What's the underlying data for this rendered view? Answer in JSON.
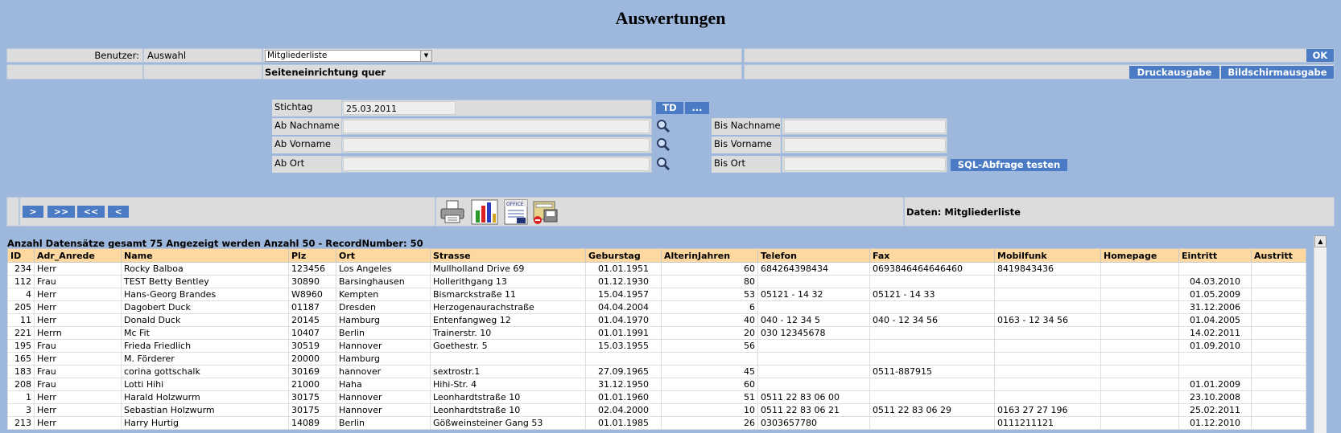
{
  "title": "Auswertungen",
  "header": {
    "benutzer_label": "Benutzer:",
    "auswahl_label": "Auswahl",
    "report_select_value": "Mitgliederliste",
    "ok_label": "OK",
    "seiten_label": "Seiteneinrichtung quer",
    "druck_label": "Druckausgabe",
    "bildschirm_label": "Bildschirmausgabe"
  },
  "filters": {
    "stichtag_label": "Stichtag",
    "stichtag_value": "25.03.2011",
    "td_label": "TD",
    "more_label": "...",
    "ab_nachname_label": "Ab Nachname",
    "bis_nachname_label": "Bis Nachname",
    "ab_vorname_label": "Ab Vorname",
    "bis_vorname_label": "Bis Vorname",
    "ab_ort_label": "Ab Ort",
    "bis_ort_label": "Bis Ort",
    "sql_test_label": "SQL-Abfrage testen"
  },
  "toolbar": {
    "next": ">",
    "last": ">>",
    "first": "<<",
    "prev": "<",
    "daten_label": "Daten: Mitgliederliste",
    "icons": [
      "printer-icon",
      "chart-icon",
      "office-icon",
      "export-icon"
    ]
  },
  "summary": "Anzahl Datensätze gesamt 75 Angezeigt werden Anzahl 50 - RecordNumber: 50",
  "table": {
    "columns": [
      "ID",
      "Adr_Anrede",
      "Name",
      "Plz",
      "Ort",
      "Strasse",
      "Geburstag",
      "AlterinJahren",
      "Telefon",
      "Fax",
      "Mobilfunk",
      "Homepage",
      "Eintritt",
      "Austritt"
    ],
    "rows": [
      [
        "234",
        "Herr",
        "Rocky Balboa",
        "123456",
        "Los Angeles",
        "Mullholland Drive 69",
        "01.01.1951",
        "60",
        "684264398434",
        "0693846464646460",
        "8419843436",
        "",
        "",
        ""
      ],
      [
        "112",
        "Frau",
        "TEST Betty Bentley",
        "30890",
        "Barsinghausen",
        "Hollerithgang 13",
        "01.12.1930",
        "80",
        "",
        "",
        "",
        "",
        "04.03.2010",
        ""
      ],
      [
        "4",
        "Herr",
        "Hans-Georg Brandes",
        "W8960",
        "Kempten",
        "Bismarckstraße 11",
        "15.04.1957",
        "53",
        "05121 - 14 32",
        "05121 - 14 33",
        "",
        "",
        "01.05.2009",
        ""
      ],
      [
        "205",
        "Herr",
        "Dagobert Duck",
        "01187",
        "Dresden",
        "Herzogenaurachstraße",
        "04.04.2004",
        "6",
        "",
        "",
        "",
        "",
        "31.12.2006",
        ""
      ],
      [
        "11",
        "Herr",
        "Donald Duck",
        "20145",
        "Hamburg",
        "Entenfangweg 12",
        "01.04.1970",
        "40",
        "040 - 12 34 5",
        "040 - 12 34 56",
        "0163 - 12 34 56",
        "",
        "01.04.2005",
        ""
      ],
      [
        "221",
        "Herrn",
        "Mc Fit",
        "10407",
        "Berlin",
        "Trainerstr. 10",
        "01.01.1991",
        "20",
        "030 12345678",
        "",
        "",
        "",
        "14.02.2011",
        ""
      ],
      [
        "195",
        "Frau",
        "Frieda Friedlich",
        "30519",
        "Hannover",
        "Goethestr. 5",
        "15.03.1955",
        "56",
        "",
        "",
        "",
        "",
        "01.09.2010",
        ""
      ],
      [
        "165",
        "Herr",
        "M. Förderer",
        "20000",
        "Hamburg",
        "",
        "",
        "",
        "",
        "",
        "",
        "",
        "",
        ""
      ],
      [
        "183",
        "Frau",
        "corina gottschalk",
        "30169",
        "hannover",
        "sextrostr.1",
        "27.09.1965",
        "45",
        "",
        "0511-887915",
        "",
        "",
        "",
        ""
      ],
      [
        "208",
        "Frau",
        "Lotti Hihi",
        "21000",
        "Haha",
        "Hihi-Str. 4",
        "31.12.1950",
        "60",
        "",
        "",
        "",
        "",
        "01.01.2009",
        ""
      ],
      [
        "1",
        "Herr",
        "Harald Holzwurm",
        "30175",
        "Hannover",
        "Leonhardtstraße 10",
        "01.01.1960",
        "51",
        "0511 22 83 06 00",
        "",
        "",
        "",
        "23.10.2008",
        ""
      ],
      [
        "3",
        "Herr",
        "Sebastian Holzwurm",
        "30175",
        "Hannover",
        "Leonhardtstraße 10",
        "02.04.2000",
        "10",
        "0511 22 83 06 21",
        "0511 22 83 06 29",
        "0163 27 27 196",
        "",
        "25.02.2011",
        ""
      ],
      [
        "213",
        "Herr",
        "Harry Hurtig",
        "14089",
        "Berlin",
        "Gößweinsteiner Gang 53",
        "01.01.1985",
        "26",
        "0303657780",
        "",
        "0111211121",
        "",
        "01.12.2010",
        ""
      ]
    ]
  }
}
